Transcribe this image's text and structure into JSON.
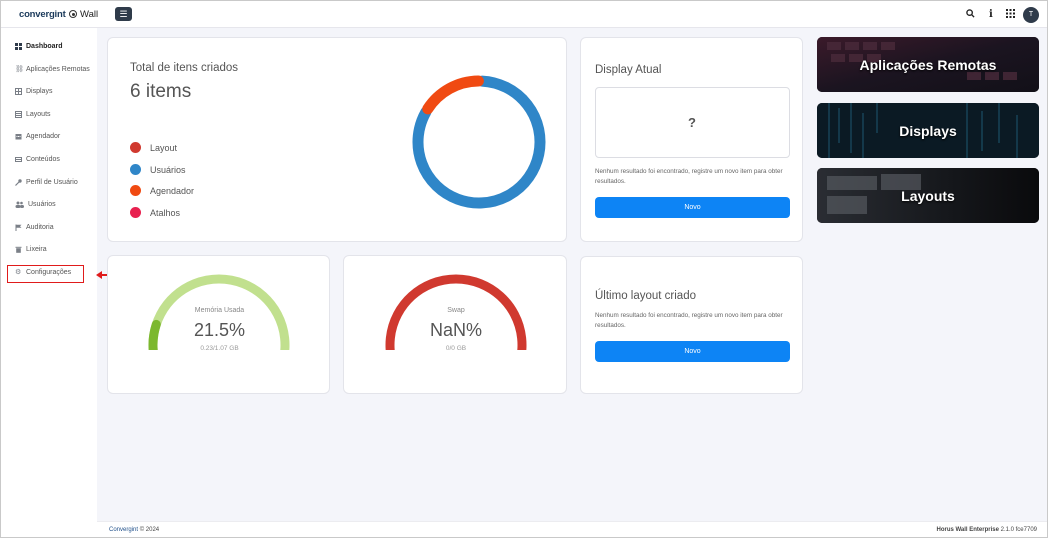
{
  "topbar": {
    "brand": "convergint",
    "product": "Wall",
    "menu_icon": "hamburger-icon",
    "icons": [
      "search-icon",
      "info-icon",
      "apps-grid-icon"
    ],
    "avatar_initial": "T"
  },
  "sidebar": {
    "items": [
      {
        "label": "Dashboard",
        "icon": "dashboard-icon"
      },
      {
        "label": "Aplicações Remotas",
        "icon": "link-icon"
      },
      {
        "label": "Displays",
        "icon": "grid-icon"
      },
      {
        "label": "Layouts",
        "icon": "layout-icon"
      },
      {
        "label": "Agendador",
        "icon": "calendar-icon"
      },
      {
        "label": "Conteúdos",
        "icon": "content-icon"
      },
      {
        "label": "Perfil de Usuário",
        "icon": "key-icon"
      },
      {
        "label": "Usuários",
        "icon": "users-icon"
      },
      {
        "label": "Auditoria",
        "icon": "flag-icon"
      },
      {
        "label": "Lixeira",
        "icon": "trash-icon"
      },
      {
        "label": "Configurações",
        "icon": "gear-icon"
      }
    ]
  },
  "summary": {
    "title": "Total de itens criados",
    "count": "6 items",
    "legend": [
      {
        "label": "Layout",
        "color": "#d0392f"
      },
      {
        "label": "Usuários",
        "color": "#2f86c8"
      },
      {
        "label": "Agendador",
        "color": "#f04a12"
      },
      {
        "label": "Atalhos",
        "color": "#e8214f"
      }
    ],
    "donut": [
      {
        "label": "Layout",
        "value": 0
      },
      {
        "label": "Usuários",
        "value": 5
      },
      {
        "label": "Agendador",
        "value": 1
      },
      {
        "label": "Atalhos",
        "value": 0
      }
    ]
  },
  "display_atual": {
    "title": "Display Atual",
    "placeholder": "?",
    "empty_text": "Nenhum resultado foi encontrado, registre um novo item para obter resultados.",
    "button": "Novo"
  },
  "tiles": [
    {
      "label": "Aplicações Remotas"
    },
    {
      "label": "Displays"
    },
    {
      "label": "Layouts"
    }
  ],
  "memory": {
    "label": "Memória Usada",
    "value": "21.5%",
    "detail": "0.23/1.07 GB",
    "fraction": 0.215,
    "color": "#7cb82f",
    "track_color": "#c1e08e"
  },
  "swap": {
    "label": "Swap",
    "value": "NaN%",
    "detail": "0/0 GB",
    "color": "#d0392f"
  },
  "ultimo_layout": {
    "title": "Último layout criado",
    "empty_text": "Nenhum resultado foi encontrado, registre um novo item para obter resultados.",
    "button": "Novo"
  },
  "footer": {
    "left_brand": "Convergint",
    "left_copy": "© 2024",
    "right_product": "Horus Wall Enterprise",
    "right_version": "2.1.0 fce7709"
  }
}
